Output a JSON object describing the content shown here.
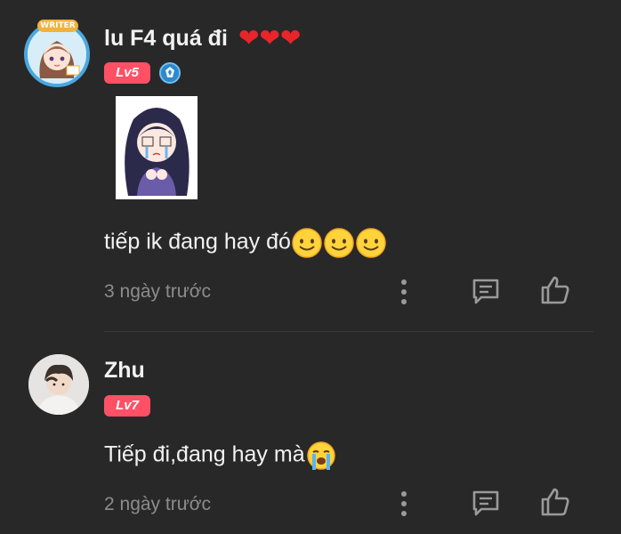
{
  "comments": [
    {
      "username": "lu F4 quá đi",
      "hearts": "❤❤❤",
      "level": "Lv5",
      "avatar_badge": "WRITER",
      "text": "tiếp ik đang hay đó",
      "emoji": [
        "smiling-face-icon",
        "smiling-face-icon",
        "smiling-face-icon"
      ],
      "time": "3 ngày trước"
    },
    {
      "username": "Zhu",
      "level": "Lv7",
      "text": "Tiếp đi,đang hay mà",
      "emoji": [
        "loudly-crying-face-icon"
      ],
      "time": "2 ngày trước"
    }
  ],
  "colors": {
    "background": "#282828",
    "level_badge": "#ff5066",
    "heart": "#e8252a",
    "text": "#f2f2f2",
    "muted": "#8c8c8c"
  }
}
